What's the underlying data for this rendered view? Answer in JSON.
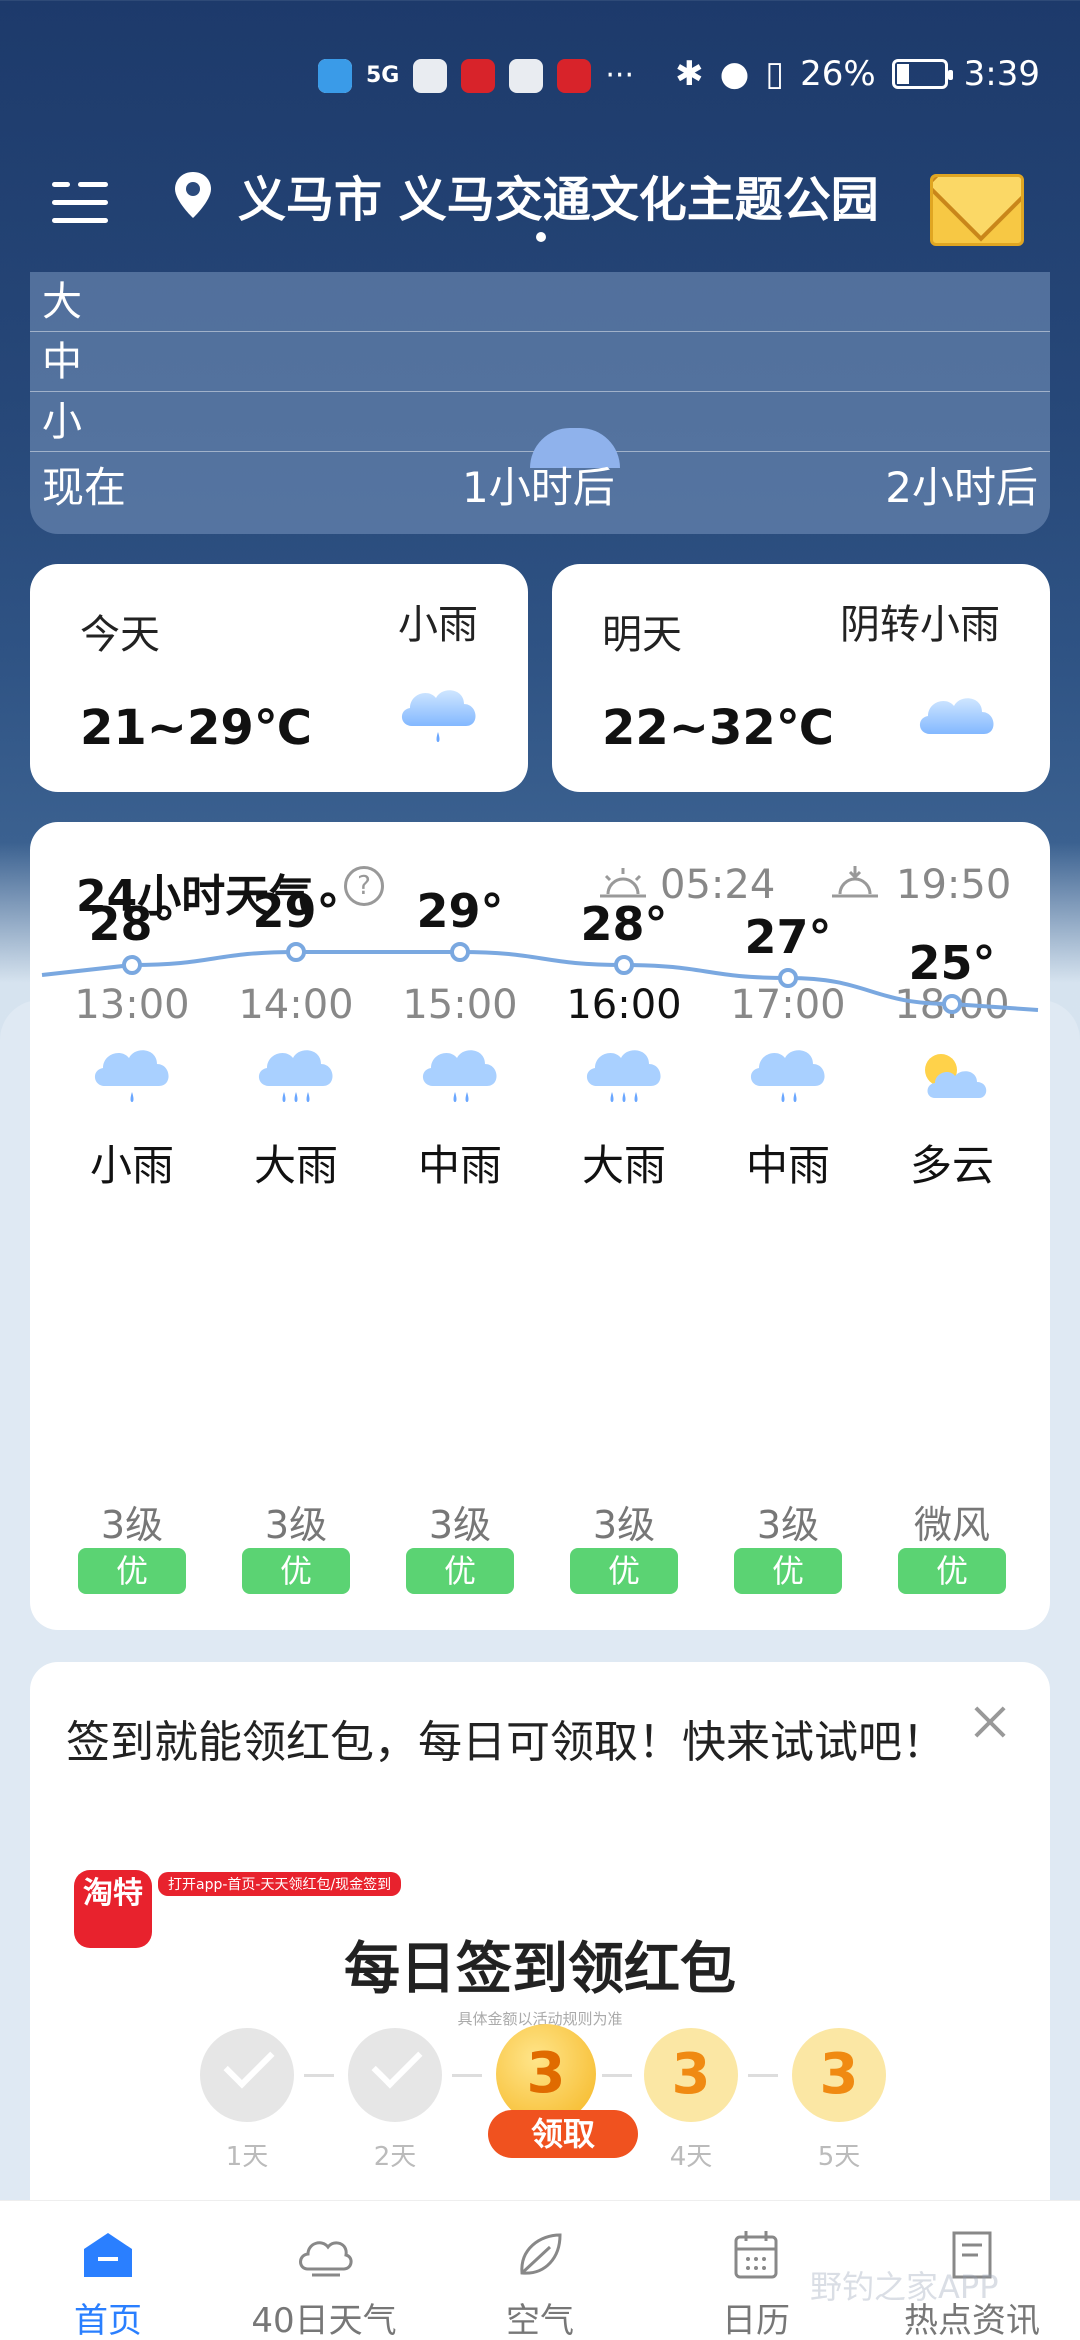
{
  "status_bar": {
    "icons": [
      "HD",
      "5G",
      "signal-icon",
      "cloud-app",
      "huawei-app",
      "red-app",
      "hand-app",
      "puzzle-app"
    ],
    "more": "···",
    "battery": "26%",
    "battery_level": 0.26,
    "time": "3:39"
  },
  "header": {
    "location": "义马市 义马交通文化主题公园"
  },
  "rain_chart": {
    "levels": [
      "大",
      "中",
      "小"
    ],
    "times": [
      "现在",
      "1小时后",
      "2小时后"
    ]
  },
  "today": {
    "label": "今天",
    "condition": "小雨",
    "temp": "21~29℃"
  },
  "tomorrow": {
    "label": "明天",
    "condition": "阴转小雨",
    "temp": "22~32℃"
  },
  "hourly": {
    "title": "24小时天气",
    "help": "?",
    "sunrise": "05:24",
    "sunset": "19:50",
    "hours": [
      {
        "time": "13:00",
        "condition": "小雨",
        "temp": "28°",
        "wind": "3级",
        "aqi": "优",
        "icon": "light-rain-icon"
      },
      {
        "time": "14:00",
        "condition": "大雨",
        "temp": "29°",
        "wind": "3级",
        "aqi": "优",
        "icon": "heavy-rain-icon"
      },
      {
        "time": "15:00",
        "condition": "中雨",
        "temp": "29°",
        "wind": "3级",
        "aqi": "优",
        "icon": "moderate-rain-icon"
      },
      {
        "time": "16:00",
        "condition": "大雨",
        "temp": "28°",
        "wind": "3级",
        "aqi": "优",
        "icon": "heavy-rain-icon"
      },
      {
        "time": "17:00",
        "condition": "中雨",
        "temp": "27°",
        "wind": "3级",
        "aqi": "优",
        "icon": "moderate-rain-icon"
      },
      {
        "time": "18:00",
        "condition": "多云",
        "temp": "25°",
        "wind": "微风",
        "aqi": "优",
        "icon": "partly-cloudy-icon"
      }
    ],
    "current_index": 3
  },
  "ad": {
    "text": "签到就能领红包，每日可领取！快来试试吧！",
    "logo_text": "淘特",
    "tag": "打开app-首页-天天领红包/现金签到",
    "title": "每日签到领红包",
    "subtitle": "具体金额以活动规则为准",
    "days": [
      "1天",
      "2天",
      "",
      "4天",
      "5天"
    ],
    "coins": [
      "3",
      "3",
      "3"
    ],
    "claim": "领取"
  },
  "bottom_nav": {
    "items": [
      {
        "label": "首页",
        "active": true
      },
      {
        "label": "40日天气",
        "active": false
      },
      {
        "label": "空气",
        "active": false
      },
      {
        "label": "日历",
        "active": false
      },
      {
        "label": "热点资讯",
        "active": false
      }
    ]
  },
  "watermark": "野钓之家APP",
  "colors": {
    "accent": "#2a7fff",
    "aqi_good": "#5bd373",
    "curve": "#7aa8e0"
  }
}
